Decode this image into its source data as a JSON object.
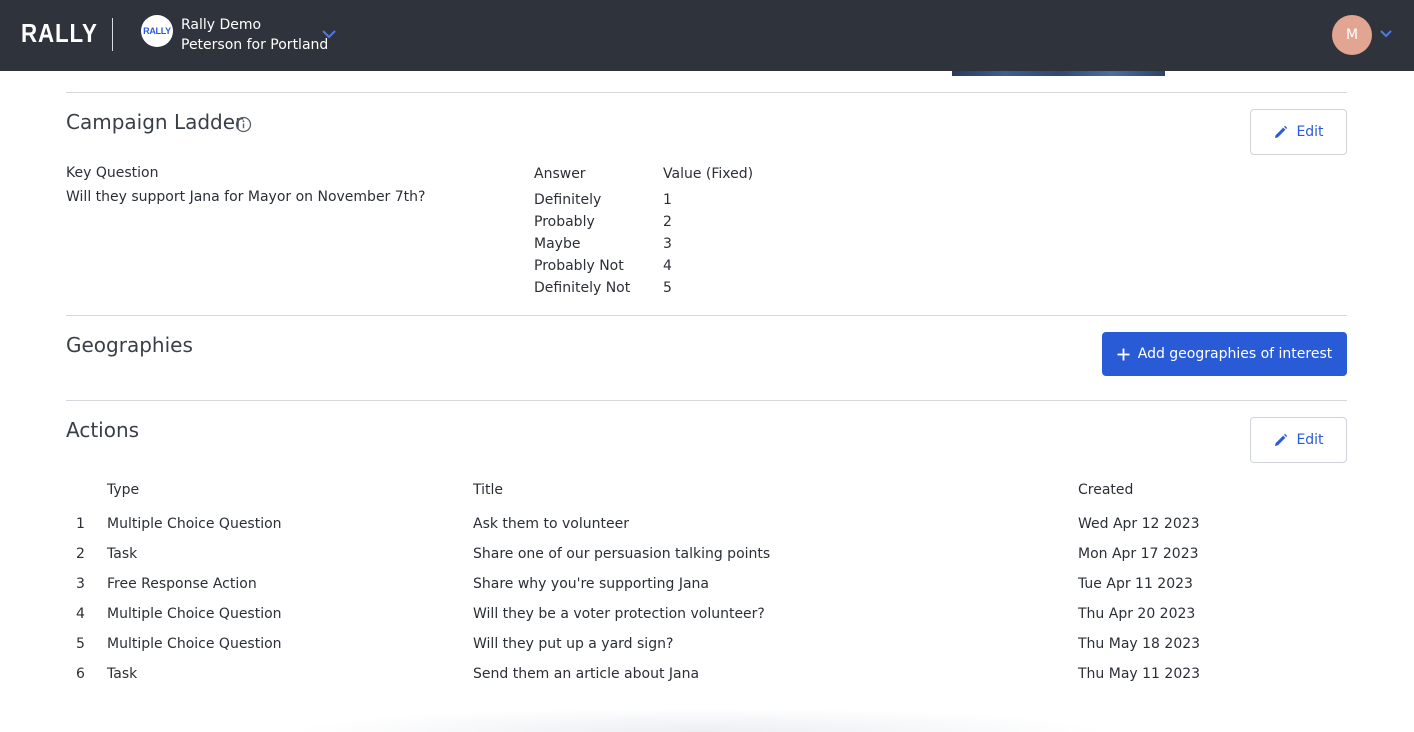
{
  "header": {
    "logo": "RALLY",
    "org_badge": "RALLY",
    "org_name": "Rally Demo",
    "org_sub": "Peterson for Portland",
    "avatar_initial": "M"
  },
  "ladder": {
    "title": "Campaign Ladder",
    "edit_label": "Edit",
    "key_question_label": "Key Question",
    "key_question": "Will they support Jana for Mayor on November 7th?",
    "answer_header": "Answer",
    "value_header": "Value (Fixed)",
    "rows": [
      {
        "answer": "Definitely",
        "value": "1"
      },
      {
        "answer": "Probably",
        "value": "2"
      },
      {
        "answer": "Maybe",
        "value": "3"
      },
      {
        "answer": "Probably Not",
        "value": "4"
      },
      {
        "answer": "Definitely Not",
        "value": "5"
      }
    ]
  },
  "geographies": {
    "title": "Geographies",
    "add_label": "Add geographies of interest"
  },
  "actions": {
    "title": "Actions",
    "edit_label": "Edit",
    "columns": {
      "type": "Type",
      "title": "Title",
      "created": "Created"
    },
    "rows": [
      {
        "num": "1",
        "type": "Multiple Choice Question",
        "title": "Ask them to volunteer",
        "created": "Wed Apr 12 2023"
      },
      {
        "num": "2",
        "type": "Task",
        "title": "Share one of our persuasion talking points",
        "created": "Mon Apr 17 2023"
      },
      {
        "num": "3",
        "type": "Free Response Action",
        "title": "Share why you're supporting Jana",
        "created": "Tue Apr 11 2023"
      },
      {
        "num": "4",
        "type": "Multiple Choice Question",
        "title": "Will they be a voter protection volunteer?",
        "created": "Thu Apr 20 2023"
      },
      {
        "num": "5",
        "type": "Multiple Choice Question",
        "title": "Will they put up a yard sign?",
        "created": "Thu May 18 2023"
      },
      {
        "num": "6",
        "type": "Task",
        "title": "Send them an article about Jana",
        "created": "Thu May 11 2023"
      }
    ]
  },
  "colors": {
    "topbar": "#2f333b",
    "accent": "#2a5bd7",
    "avatar": "#e2a592",
    "divider": "#d5d7dc"
  }
}
